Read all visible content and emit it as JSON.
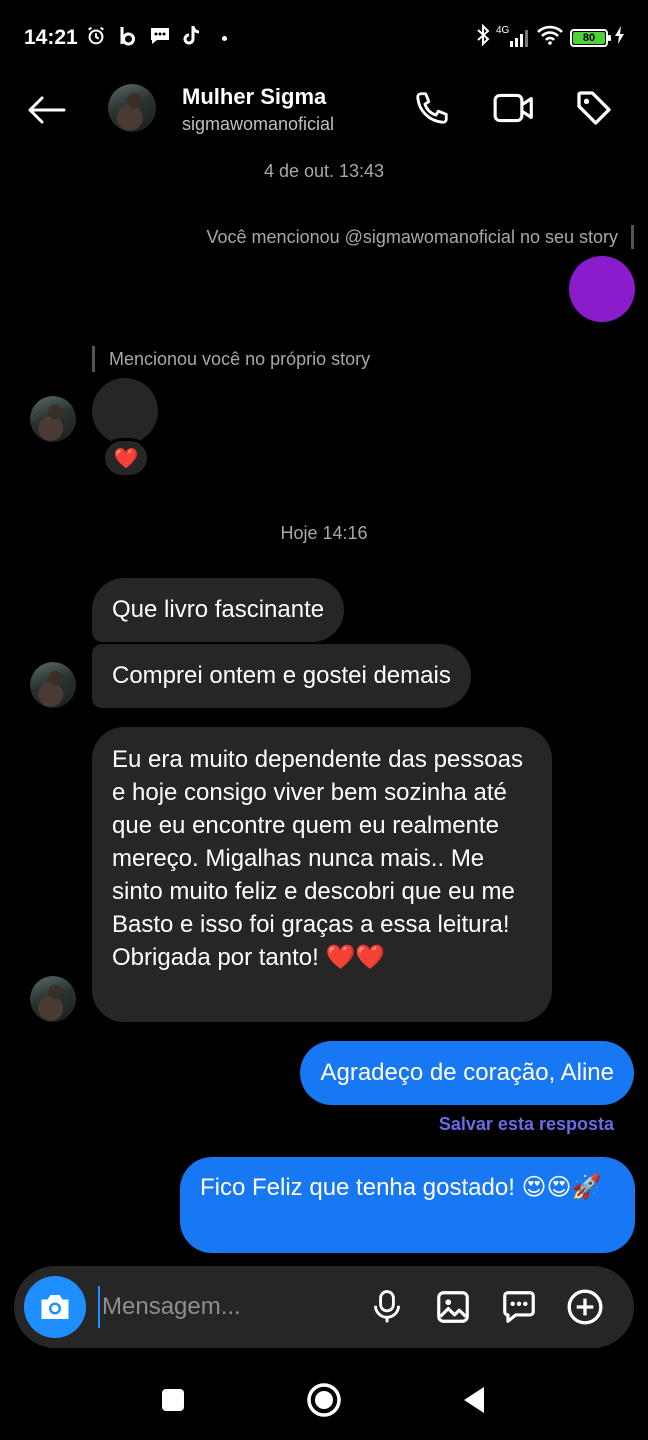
{
  "status_bar": {
    "time": "14:21",
    "network": "4G",
    "battery": "80"
  },
  "header": {
    "name": "Mulher Sigma",
    "username": "sigmawomanoficial"
  },
  "conversation": {
    "timestamp_1": "4 de out. 13:43",
    "outgoing_mention_note": "Você mencionou @sigmawomanoficial no seu story",
    "incoming_mention_note": "Mencionou você no próprio story",
    "reaction": "❤️",
    "timestamp_2": "Hoje 14:16",
    "incoming_messages": [
      "Que livro fascinante",
      "Comprei ontem e gostei demais",
      "Eu era muito dependente das pessoas e hoje consigo viver bem sozinha até que eu encontre quem eu realmente mereço. Migalhas nunca mais.. Me sinto muito feliz e descobri que eu me Basto e isso foi graças a essa leitura! Obrigada por tanto! ❤️❤️"
    ],
    "outgoing_messages": [
      "Agradeço de coração, Aline",
      "Fico Feliz que tenha gostado! 😍😍🚀"
    ],
    "save_reply": "Salvar esta resposta"
  },
  "composer": {
    "placeholder": "Mensagem..."
  },
  "colors": {
    "outgoing_bubble": "#1877f2",
    "incoming_bubble": "#262626",
    "story_outgoing": "#8a1ccc",
    "camera_button": "#1f8fff"
  }
}
